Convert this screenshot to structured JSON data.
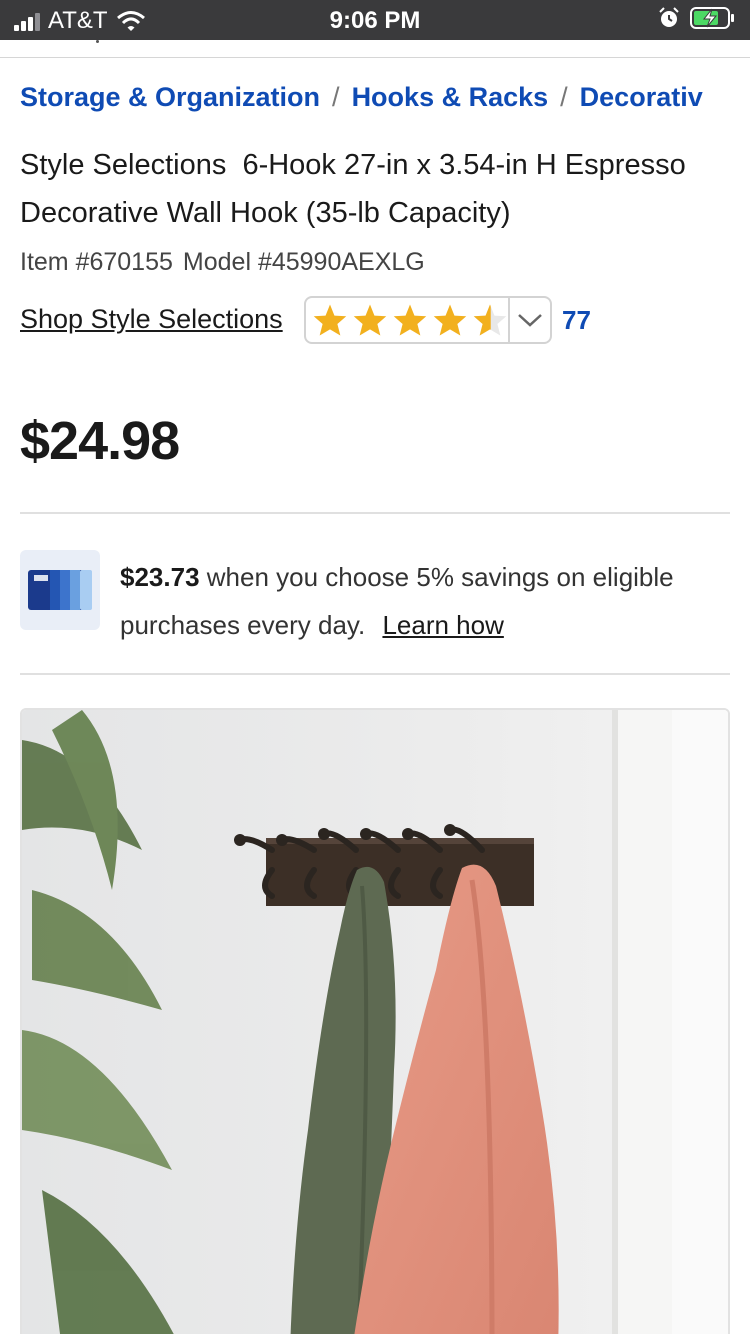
{
  "status_bar": {
    "carrier": "AT&T",
    "time": "9:06 PM"
  },
  "breadcrumb": {
    "items": [
      "Storage & Organization",
      "Hooks & Racks",
      "Decorativ"
    ],
    "separator": "/"
  },
  "product": {
    "title": "Style Selections  6-Hook 27-in x 3.54-in H Espresso Decorative Wall Hook (35-lb Capacity)",
    "item_number": "Item #670155",
    "model_number": "Model #45990AEXLG",
    "shop_link": "Shop Style Selections",
    "rating": 4.5,
    "rating_max": 5,
    "review_count": "77",
    "price": "$24.98"
  },
  "savings": {
    "amount": "$23.73",
    "text": "when you choose 5% savings on eligible purchases every day.",
    "link": "Learn how"
  },
  "image": {
    "alt_icon": "product-photo"
  },
  "colors": {
    "link_blue": "#0f4bb4",
    "star_gold": "#f2b01e",
    "status_bar": "#3a3a3c"
  }
}
